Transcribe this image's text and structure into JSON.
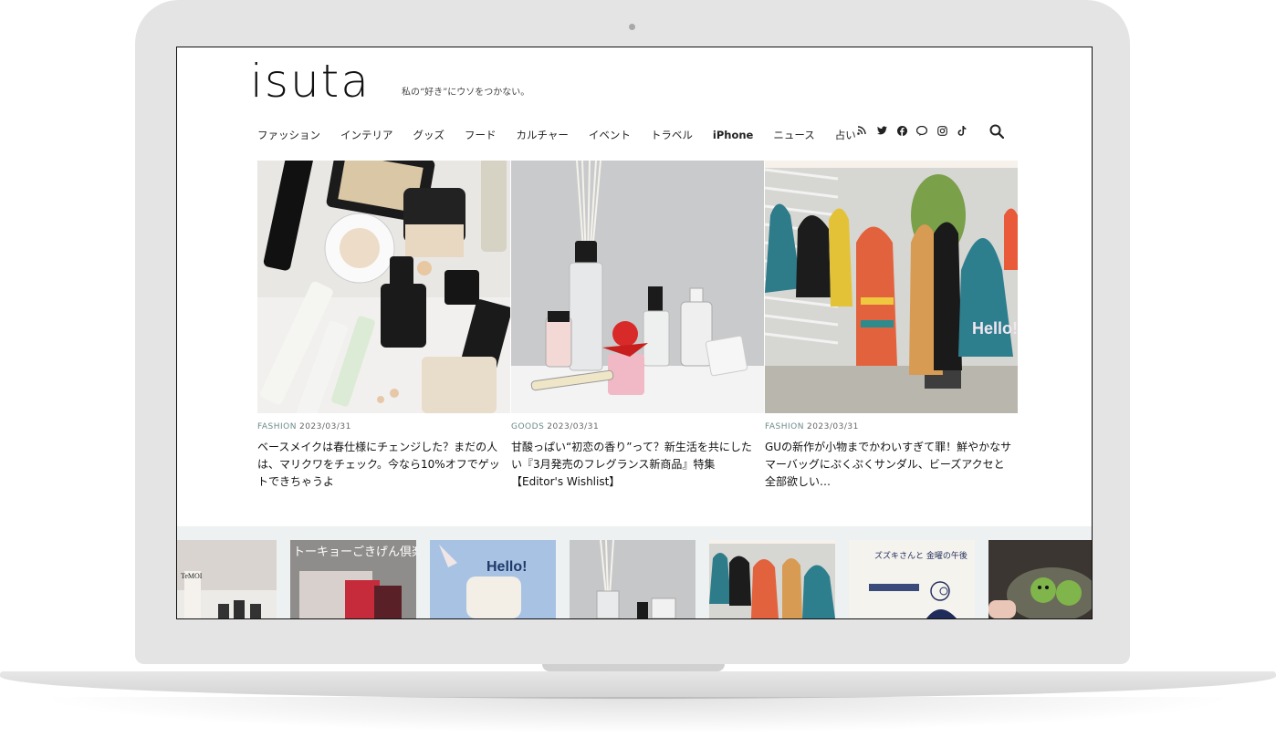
{
  "site": {
    "logo": "isuta",
    "tagline": "私の“好き”にウソをつかない。"
  },
  "nav": {
    "items": [
      {
        "label": "ファッション"
      },
      {
        "label": "インテリア"
      },
      {
        "label": "グッズ"
      },
      {
        "label": "フード"
      },
      {
        "label": "カルチャー"
      },
      {
        "label": "イベント"
      },
      {
        "label": "トラベル"
      },
      {
        "label": "iPhone"
      },
      {
        "label": "ニュース"
      },
      {
        "label": "占い"
      }
    ],
    "social_icons": [
      "rss-icon",
      "twitter-icon",
      "facebook-icon",
      "line-icon",
      "instagram-icon",
      "tiktok-icon"
    ],
    "search_icon": "search-icon"
  },
  "features": [
    {
      "category": "FASHION",
      "date": "2023/03/31",
      "title": "ベースメイクは春仕様にチェンジした？まだの人は、マリクワをチェック。今なら10%オフでゲットできちゃうよ"
    },
    {
      "category": "GOODS",
      "date": "2023/03/31",
      "title": "甘酸っぱい“初恋の香り”って？新生活を共にしたい『3月発売のフレグランス新商品』特集【Editor's Wishlist】"
    },
    {
      "category": "FASHION",
      "date": "2023/03/31",
      "title": "GUの新作が小物までかわいすぎて罪！鮮やかなサマーバッグにぷくぷくサンダル、ビーズアクセと全部欲しい…"
    }
  ],
  "strip": {
    "thumbs": [
      {
        "text": "TeMOI"
      },
      {
        "text": "トーキョーごきげん倶楽部"
      },
      {
        "text": "Hello!"
      },
      {
        "text": ""
      },
      {
        "text": ""
      },
      {
        "text": "ズズキさんと 金曜の午後"
      },
      {
        "text": ""
      }
    ]
  },
  "colors": {
    "accent_category": "#6c8a8a",
    "strip_bg": "#eef1f1"
  }
}
